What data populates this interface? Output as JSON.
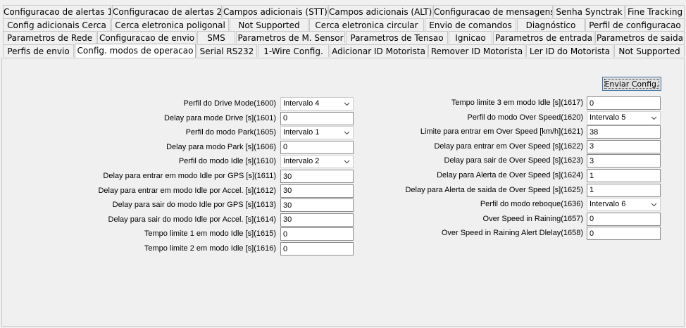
{
  "tabs": {
    "row1": [
      "Configuracao de alertas 1",
      "Configuracao de alertas 2",
      "Campos adicionais (STT)",
      "Campos adicionais (ALT)",
      "Configuracao de mensagens",
      "Senha Synctrak",
      "Fine Tracking"
    ],
    "row2": [
      "Config adicionais Cerca",
      "Cerca eletronica poligonal",
      "Not Supported",
      "Cerca eletronica circular",
      "Envio de comandos",
      "Diagnóstico",
      "Perfil de configuracao"
    ],
    "row3": [
      "Parametros de Rede",
      "Configuracao de envio",
      "SMS",
      "Parametros de M. Sensor",
      "Parametros de Tensao",
      "Ignicao",
      "Parametros de entrada",
      "Parametros de saida"
    ],
    "row4": [
      "Perfis de envio",
      "Config. modos de operacao",
      "Serial RS232",
      "1-Wire Config.",
      "Adicionar ID Motorista",
      "Remover ID Motorista",
      "Ler ID do Motorista",
      "Not Supported"
    ],
    "active": "Config. modos de operacao"
  },
  "send_button": "Enviar Config.",
  "left": [
    {
      "label": "Perfil do Drive Mode(1600)",
      "value": "Intervalo 4",
      "kind": "select"
    },
    {
      "label": "Delay para mode Drive [s](1601)",
      "value": "0",
      "kind": "text"
    },
    {
      "label": "Perfil do modo Park(1605)",
      "value": "Intervalo 1",
      "kind": "select"
    },
    {
      "label": "Delay para modo Park [s](1606)",
      "value": "0",
      "kind": "text"
    },
    {
      "label": "Perfil do modo Idle [s](1610)",
      "value": "Intervalo 2",
      "kind": "select"
    },
    {
      "label": "Delay para entrar em modo Idle por GPS [s](1611)",
      "value": "30",
      "kind": "text"
    },
    {
      "label": "Delay para entrar em modo Idle por Accel. [s](1612)",
      "value": "30",
      "kind": "text"
    },
    {
      "label": "Delay para sair do modo Idle por GPS [s](1613)",
      "value": "30",
      "kind": "text"
    },
    {
      "label": "Delay para sair do modo Idle por Accel. [s](1614)",
      "value": "30",
      "kind": "text"
    },
    {
      "label": "Tempo limite 1 em modo Idle [s](1615)",
      "value": "0",
      "kind": "text"
    },
    {
      "label": "Tempo limite 2 em modo Idle [s](1616)",
      "value": "0",
      "kind": "text"
    }
  ],
  "right": [
    {
      "label": "Tempo limite 3 em modo Idle [s](1617)",
      "value": "0",
      "kind": "text"
    },
    {
      "label": "Perfil do modo Over Speed(1620)",
      "value": "Intervalo 5",
      "kind": "select"
    },
    {
      "label": "Limite para entrar em Over Speed [km/h](1621)",
      "value": "38",
      "kind": "text"
    },
    {
      "label": "Delay para entrar em Over Speed [s](1622)",
      "value": "3",
      "kind": "text"
    },
    {
      "label": "Delay para sair de Over Speed [s](1623)",
      "value": "3",
      "kind": "text"
    },
    {
      "label": "Delay para Alerta de Over Speed [s](1624)",
      "value": "1",
      "kind": "text"
    },
    {
      "label": "Delay para Alerta de saida de Over Speed [s](1625)",
      "value": "1",
      "kind": "text"
    },
    {
      "label": "Perfil do modo reboque(1636)",
      "value": "Intervalo 6",
      "kind": "select"
    },
    {
      "label": "Over Speed in Raining(1657)",
      "value": "0",
      "kind": "text"
    },
    {
      "label": "Over Speed in Raining Alert Dlelay(1658)",
      "value": "0",
      "kind": "text"
    }
  ]
}
